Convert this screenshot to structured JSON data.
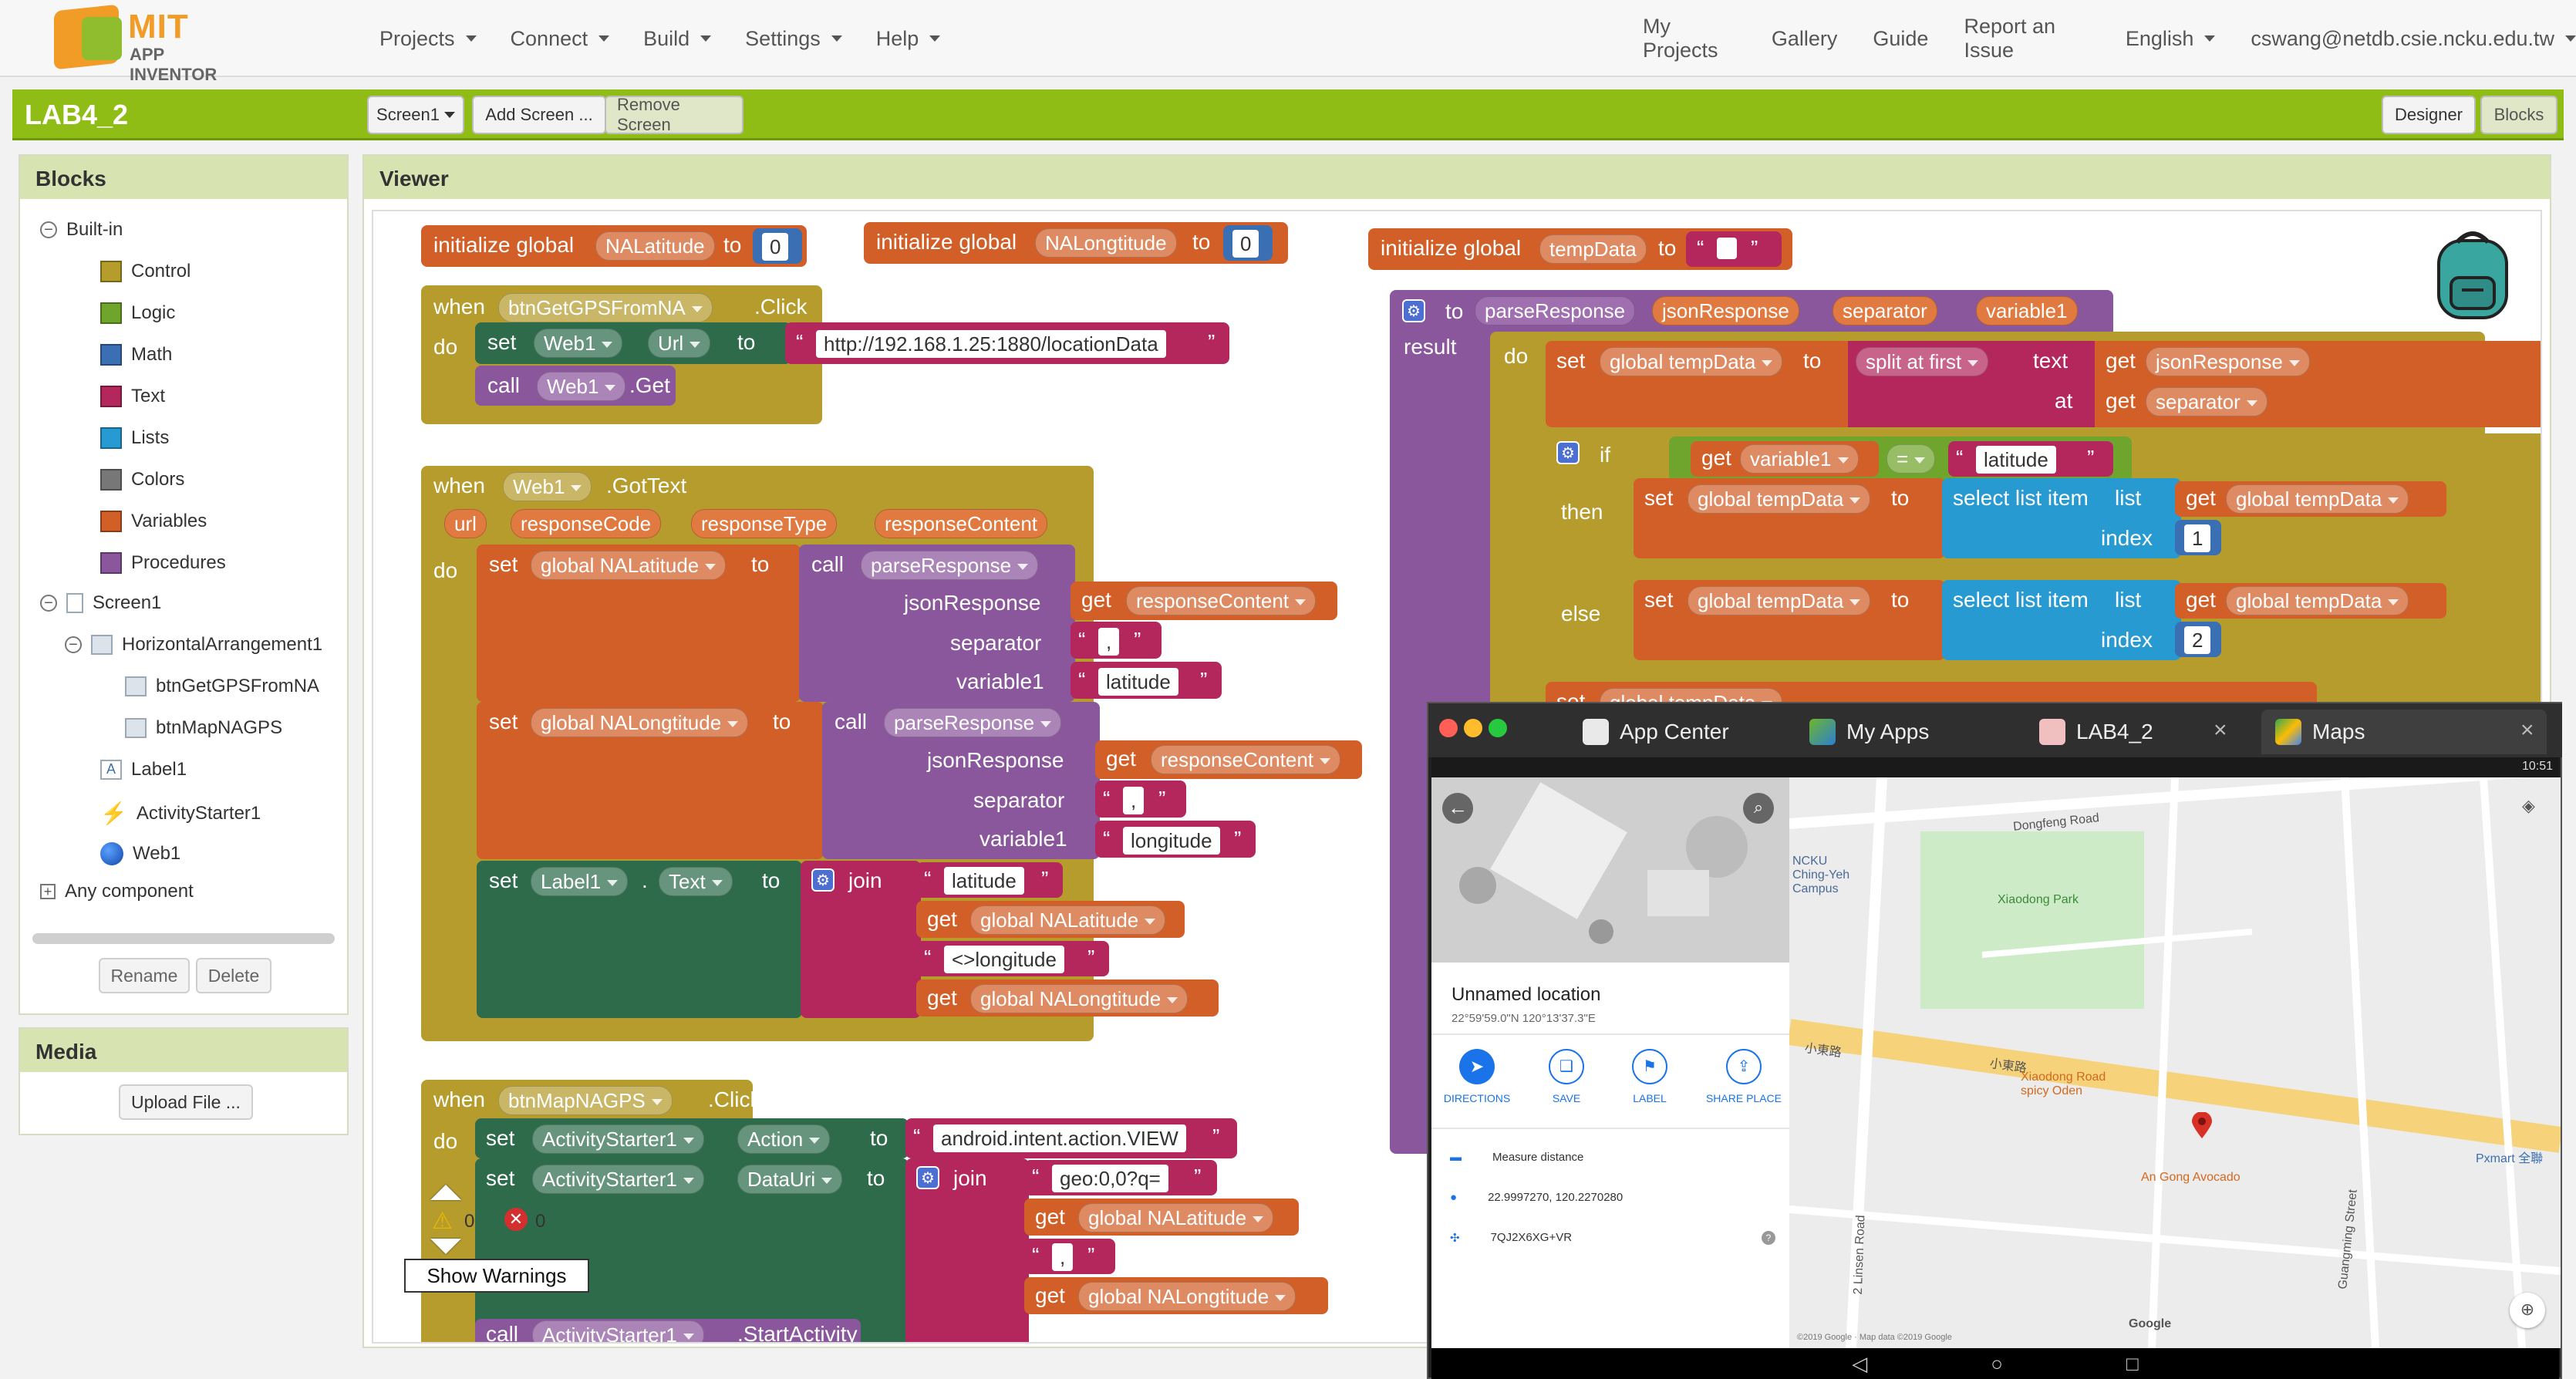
{
  "app": {
    "logo_top": "MIT",
    "logo_bottom": "APP INVENTOR"
  },
  "nav": {
    "menus": [
      "Projects",
      "Connect",
      "Build",
      "Settings",
      "Help"
    ],
    "right": [
      "My Projects",
      "Gallery",
      "Guide",
      "Report an Issue",
      "English",
      "cswang@netdb.csie.ncku.edu.tw"
    ]
  },
  "project": {
    "name": "LAB4_2",
    "screen_select": "Screen1",
    "add_screen": "Add Screen ...",
    "remove_screen": "Remove Screen",
    "designer": "Designer",
    "blocks": "Blocks"
  },
  "blocks_panel": {
    "title": "Blocks",
    "builtin": "Built-in",
    "builtin_items": [
      {
        "label": "Control",
        "color": "#b59c2d"
      },
      {
        "label": "Logic",
        "color": "#6fa52c"
      },
      {
        "label": "Math",
        "color": "#3b6fb3"
      },
      {
        "label": "Text",
        "color": "#b3275c"
      },
      {
        "label": "Lists",
        "color": "#289ad2"
      },
      {
        "label": "Colors",
        "color": "#777777"
      },
      {
        "label": "Variables",
        "color": "#d25f28"
      },
      {
        "label": "Procedures",
        "color": "#8b579c"
      }
    ],
    "screen": "Screen1",
    "arrangement": "HorizontalArrangement1",
    "components": [
      "btnGetGPSFromNA",
      "btnMapNAGPS"
    ],
    "others": [
      "Label1",
      "ActivityStarter1",
      "Web1"
    ],
    "any_component": "Any component",
    "rename": "Rename",
    "delete": "Delete"
  },
  "media": {
    "title": "Media",
    "upload": "Upload File ..."
  },
  "viewer": {
    "title": "Viewer"
  },
  "code": {
    "init1": {
      "kw": "initialize global",
      "name": "NALatitude",
      "to": "to",
      "val": "0"
    },
    "init2": {
      "kw": "initialize global",
      "name": "NALongtitude",
      "to": "to",
      "val": "0"
    },
    "init3": {
      "kw": "initialize global",
      "name": "tempData",
      "to": "to",
      "open": "“",
      "close": "”"
    },
    "ev1": {
      "when": "when",
      "comp": "btnGetGPSFromNA",
      "event": ".Click",
      "do": "do",
      "set": "set",
      "web": "Web1",
      "url": "Url",
      "to": "to",
      "text": "http://192.168.1.25:1880/locationData",
      "call": "call",
      "get": ".Get"
    },
    "ev2": {
      "when": "when",
      "comp": "Web1",
      "event": ".GotText",
      "params": [
        "url",
        "responseCode",
        "responseType",
        "responseContent"
      ],
      "do": "do",
      "set": "set",
      "lat": "global NALatitude",
      "lng": "global NALongtitude",
      "to": "to",
      "call": "call",
      "proc": "parseResponse",
      "jr": "jsonResponse",
      "sep": "separator",
      "v1": "variable1",
      "get": "get",
      "rc": "responseContent",
      "comma": ",",
      "latitude": "latitude",
      "longitude": "longitude",
      "label": "Label1",
      "dot": ".",
      "text": "Text",
      "join": "join",
      "s_lat": "latitude",
      "s_lng": "<>longitude"
    },
    "ev3": {
      "when": "when",
      "comp": "btnMapNAGPS",
      "event": ".Click",
      "do": "do",
      "set": "set",
      "as": "ActivityStarter1",
      "action": "Action",
      "to": "to",
      "intent": "android.intent.action.VIEW",
      "datauri": "DataUri",
      "join": "join",
      "geo": "geo:0,0?q=",
      "get": "get",
      "lat": "global NALatitude",
      "comma": ",",
      "lng": "global NALongtitude",
      "call": "call",
      "start": ".StartActivity"
    },
    "proc": {
      "to": "to",
      "name": "parseResponse",
      "params": [
        "jsonResponse",
        "separator",
        "variable1"
      ],
      "result": "result",
      "do": "do",
      "set": "set",
      "td": "global tempData",
      "to2": "to",
      "split": "split at first",
      "text": "text",
      "at": "at",
      "get": "get",
      "jr": "jsonResponse",
      "sep": "separator",
      "if": "if",
      "v1": "variable1",
      "eq": "=",
      "lat": "latitude",
      "then": "then",
      "else": "else",
      "sel": "select list item",
      "list": "list",
      "index": "index",
      "i1": "1",
      "i2": "2"
    },
    "warnings": {
      "warn_count": "0",
      "err_count": "0",
      "show": "Show Warnings"
    }
  },
  "emulator": {
    "tabs": [
      "App Center",
      "My Apps",
      "LAB4_2",
      "Maps"
    ],
    "time": "10:51",
    "place": {
      "title": "Unnamed location",
      "coords": "22°59'59.0\"N 120°13'37.3\"E"
    },
    "actions": [
      "DIRECTIONS",
      "SAVE",
      "LABEL",
      "SHARE PLACE"
    ],
    "rows": [
      "Measure distance",
      "22.9997270, 120.2270280",
      "7QJ2X6XG+VR"
    ],
    "map_labels": [
      "小東路",
      "小東路",
      "Dongfeng Road",
      "Xiaodong Park",
      "NCKU Ching-Yeh Campus",
      "Xiaodong Road spicy Oden",
      "An Gong Avocado",
      "Pxmart 全聯",
      "Guangming Street",
      "2 Linsen Road",
      "Google",
      "©2019 Google · Map data ©2019 Google"
    ],
    "colors": {
      "pin": "#d93025",
      "road": "#f6d27a",
      "park": "#cdebc6"
    }
  }
}
